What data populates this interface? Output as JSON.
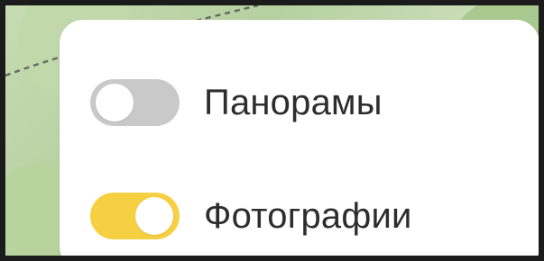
{
  "map": {
    "background": "map"
  },
  "layers_panel": {
    "toggles": [
      {
        "label": "Панорамы",
        "state": "off",
        "track_color": "#c9c9c9"
      },
      {
        "label": "Фотографии",
        "state": "on",
        "track_color": "#f6cf43"
      }
    ]
  },
  "colors": {
    "panel_bg": "#ffffff",
    "text": "#2d2d2d",
    "knob": "#ffffff",
    "frame_border": "#1b1b1b"
  }
}
